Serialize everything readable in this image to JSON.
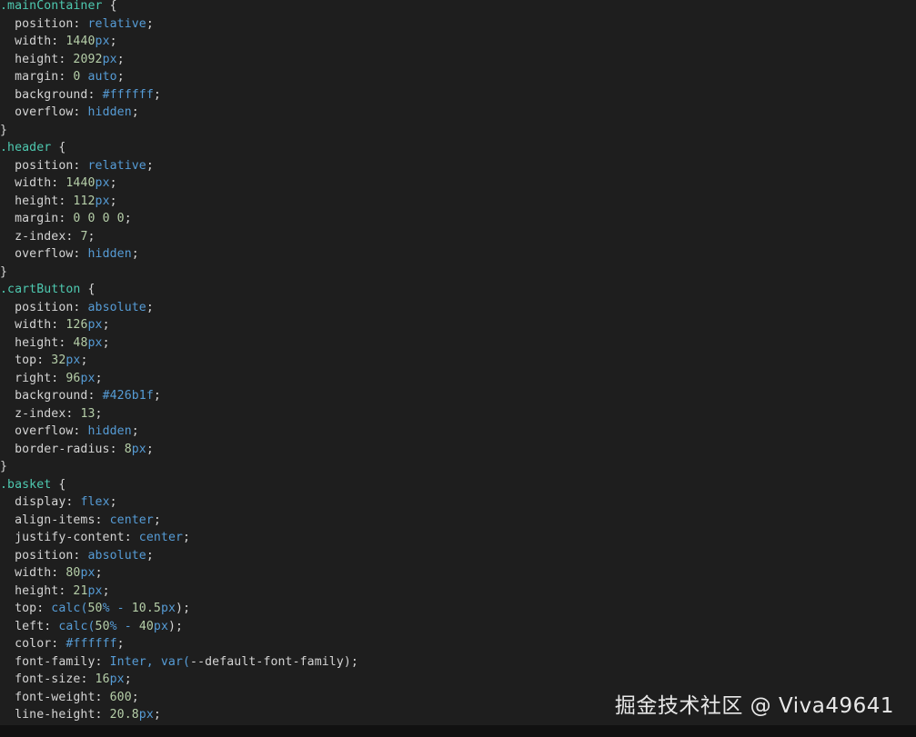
{
  "colors": {
    "background": "#1e1e1e",
    "selector": "#4ec9b0",
    "property": "#d4d4d4",
    "number": "#b5cea8",
    "keyword": "#569cd6"
  },
  "code_lines": [
    [
      {
        "t": ".mainContainer",
        "c": "sel"
      },
      {
        "t": " {",
        "c": "punc"
      }
    ],
    [
      {
        "t": "  position",
        "c": "prop"
      },
      {
        "t": ": ",
        "c": "punc"
      },
      {
        "t": "relative",
        "c": "kw"
      },
      {
        "t": ";",
        "c": "punc"
      }
    ],
    [
      {
        "t": "  width",
        "c": "prop"
      },
      {
        "t": ": ",
        "c": "punc"
      },
      {
        "t": "1440",
        "c": "num"
      },
      {
        "t": "px",
        "c": "kw"
      },
      {
        "t": ";",
        "c": "punc"
      }
    ],
    [
      {
        "t": "  height",
        "c": "prop"
      },
      {
        "t": ": ",
        "c": "punc"
      },
      {
        "t": "2092",
        "c": "num"
      },
      {
        "t": "px",
        "c": "kw"
      },
      {
        "t": ";",
        "c": "punc"
      }
    ],
    [
      {
        "t": "  margin",
        "c": "prop"
      },
      {
        "t": ": ",
        "c": "punc"
      },
      {
        "t": "0",
        "c": "num"
      },
      {
        "t": " ",
        "c": "punc"
      },
      {
        "t": "auto",
        "c": "kw"
      },
      {
        "t": ";",
        "c": "punc"
      }
    ],
    [
      {
        "t": "  background",
        "c": "prop"
      },
      {
        "t": ": ",
        "c": "punc"
      },
      {
        "t": "#ffffff",
        "c": "kw"
      },
      {
        "t": ";",
        "c": "punc"
      }
    ],
    [
      {
        "t": "  overflow",
        "c": "prop"
      },
      {
        "t": ": ",
        "c": "punc"
      },
      {
        "t": "hidden",
        "c": "kw"
      },
      {
        "t": ";",
        "c": "punc"
      }
    ],
    [
      {
        "t": "}",
        "c": "punc"
      }
    ],
    [
      {
        "t": ".header",
        "c": "sel"
      },
      {
        "t": " {",
        "c": "punc"
      }
    ],
    [
      {
        "t": "  position",
        "c": "prop"
      },
      {
        "t": ": ",
        "c": "punc"
      },
      {
        "t": "relative",
        "c": "kw"
      },
      {
        "t": ";",
        "c": "punc"
      }
    ],
    [
      {
        "t": "  width",
        "c": "prop"
      },
      {
        "t": ": ",
        "c": "punc"
      },
      {
        "t": "1440",
        "c": "num"
      },
      {
        "t": "px",
        "c": "kw"
      },
      {
        "t": ";",
        "c": "punc"
      }
    ],
    [
      {
        "t": "  height",
        "c": "prop"
      },
      {
        "t": ": ",
        "c": "punc"
      },
      {
        "t": "112",
        "c": "num"
      },
      {
        "t": "px",
        "c": "kw"
      },
      {
        "t": ";",
        "c": "punc"
      }
    ],
    [
      {
        "t": "  margin",
        "c": "prop"
      },
      {
        "t": ": ",
        "c": "punc"
      },
      {
        "t": "0 0 0 0",
        "c": "num"
      },
      {
        "t": ";",
        "c": "punc"
      }
    ],
    [
      {
        "t": "  z-index",
        "c": "prop"
      },
      {
        "t": ": ",
        "c": "punc"
      },
      {
        "t": "7",
        "c": "num"
      },
      {
        "t": ";",
        "c": "punc"
      }
    ],
    [
      {
        "t": "  overflow",
        "c": "prop"
      },
      {
        "t": ": ",
        "c": "punc"
      },
      {
        "t": "hidden",
        "c": "kw"
      },
      {
        "t": ";",
        "c": "punc"
      }
    ],
    [
      {
        "t": "}",
        "c": "punc"
      }
    ],
    [
      {
        "t": ".cartButton",
        "c": "sel"
      },
      {
        "t": " {",
        "c": "punc"
      }
    ],
    [
      {
        "t": "  position",
        "c": "prop"
      },
      {
        "t": ": ",
        "c": "punc"
      },
      {
        "t": "absolute",
        "c": "kw"
      },
      {
        "t": ";",
        "c": "punc"
      }
    ],
    [
      {
        "t": "  width",
        "c": "prop"
      },
      {
        "t": ": ",
        "c": "punc"
      },
      {
        "t": "126",
        "c": "num"
      },
      {
        "t": "px",
        "c": "kw"
      },
      {
        "t": ";",
        "c": "punc"
      }
    ],
    [
      {
        "t": "  height",
        "c": "prop"
      },
      {
        "t": ": ",
        "c": "punc"
      },
      {
        "t": "48",
        "c": "num"
      },
      {
        "t": "px",
        "c": "kw"
      },
      {
        "t": ";",
        "c": "punc"
      }
    ],
    [
      {
        "t": "  top",
        "c": "prop"
      },
      {
        "t": ": ",
        "c": "punc"
      },
      {
        "t": "32",
        "c": "num"
      },
      {
        "t": "px",
        "c": "kw"
      },
      {
        "t": ";",
        "c": "punc"
      }
    ],
    [
      {
        "t": "  right",
        "c": "prop"
      },
      {
        "t": ": ",
        "c": "punc"
      },
      {
        "t": "96",
        "c": "num"
      },
      {
        "t": "px",
        "c": "kw"
      },
      {
        "t": ";",
        "c": "punc"
      }
    ],
    [
      {
        "t": "  background",
        "c": "prop"
      },
      {
        "t": ": ",
        "c": "punc"
      },
      {
        "t": "#426b1f",
        "c": "kw"
      },
      {
        "t": ";",
        "c": "punc"
      }
    ],
    [
      {
        "t": "  z-index",
        "c": "prop"
      },
      {
        "t": ": ",
        "c": "punc"
      },
      {
        "t": "13",
        "c": "num"
      },
      {
        "t": ";",
        "c": "punc"
      }
    ],
    [
      {
        "t": "  overflow",
        "c": "prop"
      },
      {
        "t": ": ",
        "c": "punc"
      },
      {
        "t": "hidden",
        "c": "kw"
      },
      {
        "t": ";",
        "c": "punc"
      }
    ],
    [
      {
        "t": "  border-radius",
        "c": "prop"
      },
      {
        "t": ": ",
        "c": "punc"
      },
      {
        "t": "8",
        "c": "num"
      },
      {
        "t": "px",
        "c": "kw"
      },
      {
        "t": ";",
        "c": "punc"
      }
    ],
    [
      {
        "t": "}",
        "c": "punc"
      }
    ],
    [
      {
        "t": ".basket",
        "c": "sel"
      },
      {
        "t": " {",
        "c": "punc"
      }
    ],
    [
      {
        "t": "  display",
        "c": "prop"
      },
      {
        "t": ": ",
        "c": "punc"
      },
      {
        "t": "flex",
        "c": "kw"
      },
      {
        "t": ";",
        "c": "punc"
      }
    ],
    [
      {
        "t": "  align-items",
        "c": "prop"
      },
      {
        "t": ": ",
        "c": "punc"
      },
      {
        "t": "center",
        "c": "kw"
      },
      {
        "t": ";",
        "c": "punc"
      }
    ],
    [
      {
        "t": "  justify-content",
        "c": "prop"
      },
      {
        "t": ": ",
        "c": "punc"
      },
      {
        "t": "center",
        "c": "kw"
      },
      {
        "t": ";",
        "c": "punc"
      }
    ],
    [
      {
        "t": "  position",
        "c": "prop"
      },
      {
        "t": ": ",
        "c": "punc"
      },
      {
        "t": "absolute",
        "c": "kw"
      },
      {
        "t": ";",
        "c": "punc"
      }
    ],
    [
      {
        "t": "  width",
        "c": "prop"
      },
      {
        "t": ": ",
        "c": "punc"
      },
      {
        "t": "80",
        "c": "num"
      },
      {
        "t": "px",
        "c": "kw"
      },
      {
        "t": ";",
        "c": "punc"
      }
    ],
    [
      {
        "t": "  height",
        "c": "prop"
      },
      {
        "t": ": ",
        "c": "punc"
      },
      {
        "t": "21",
        "c": "num"
      },
      {
        "t": "px",
        "c": "kw"
      },
      {
        "t": ";",
        "c": "punc"
      }
    ],
    [
      {
        "t": "  top",
        "c": "prop"
      },
      {
        "t": ": ",
        "c": "punc"
      },
      {
        "t": "calc(",
        "c": "fn"
      },
      {
        "t": "50",
        "c": "num"
      },
      {
        "t": "% - ",
        "c": "kw"
      },
      {
        "t": "10.5",
        "c": "num"
      },
      {
        "t": "px",
        "c": "kw"
      },
      {
        "t": ");",
        "c": "punc"
      }
    ],
    [
      {
        "t": "  left",
        "c": "prop"
      },
      {
        "t": ": ",
        "c": "punc"
      },
      {
        "t": "calc(",
        "c": "fn"
      },
      {
        "t": "50",
        "c": "num"
      },
      {
        "t": "% - ",
        "c": "kw"
      },
      {
        "t": "40",
        "c": "num"
      },
      {
        "t": "px",
        "c": "kw"
      },
      {
        "t": ");",
        "c": "punc"
      }
    ],
    [
      {
        "t": "  color",
        "c": "prop"
      },
      {
        "t": ": ",
        "c": "punc"
      },
      {
        "t": "#ffffff",
        "c": "kw"
      },
      {
        "t": ";",
        "c": "punc"
      }
    ],
    [
      {
        "t": "  font-family",
        "c": "prop"
      },
      {
        "t": ": ",
        "c": "punc"
      },
      {
        "t": "Inter, var(",
        "c": "kw"
      },
      {
        "t": "--default-font-family",
        "c": "prop"
      },
      {
        "t": ");",
        "c": "punc"
      }
    ],
    [
      {
        "t": "  font-size",
        "c": "prop"
      },
      {
        "t": ": ",
        "c": "punc"
      },
      {
        "t": "16",
        "c": "num"
      },
      {
        "t": "px",
        "c": "kw"
      },
      {
        "t": ";",
        "c": "punc"
      }
    ],
    [
      {
        "t": "  font-weight",
        "c": "prop"
      },
      {
        "t": ": ",
        "c": "punc"
      },
      {
        "t": "600",
        "c": "num"
      },
      {
        "t": ";",
        "c": "punc"
      }
    ],
    [
      {
        "t": "  line-height",
        "c": "prop"
      },
      {
        "t": ": ",
        "c": "punc"
      },
      {
        "t": "20.8",
        "c": "num"
      },
      {
        "t": "px",
        "c": "kw"
      },
      {
        "t": ";",
        "c": "punc"
      }
    ]
  ],
  "watermark": {
    "text": "掘金技术社区 @ Viva49641"
  }
}
